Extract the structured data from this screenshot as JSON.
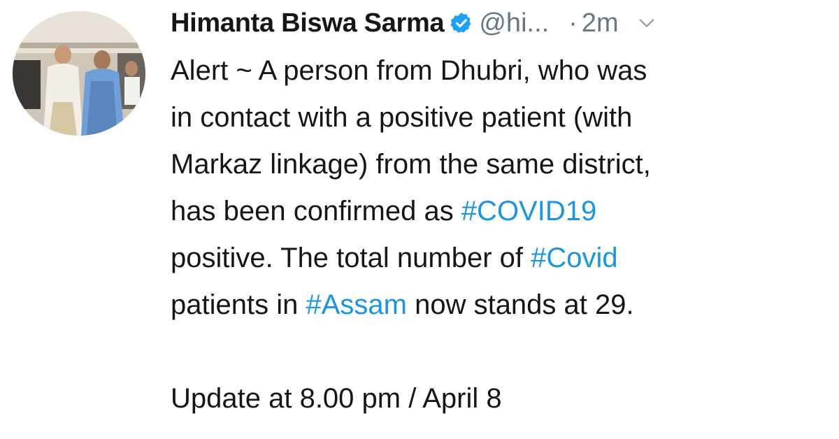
{
  "author": {
    "display_name": "Himanta Biswa Sarma",
    "handle": "@hi...",
    "separator": "·",
    "time": "2m",
    "verified_icon": "verified-badge-icon",
    "menu_icon": "chevron-down-icon"
  },
  "tweet": {
    "lines": [
      {
        "text": "Alert ~ A person from Dhubri, who was"
      },
      {
        "text": "in contact with a positive patient (with"
      },
      {
        "text": "Markaz linkage) from the same district,"
      },
      {
        "pre": "has been confirmed as ",
        "tag": "#COVID19",
        "post": ""
      },
      {
        "pre": "positive. The total number of ",
        "tag": "#Covid",
        "post": ""
      },
      {
        "pre": "patients in ",
        "tag": "#Assam",
        "post": " now stands at 29."
      }
    ],
    "update_line": "Update at 8.00 pm / April 8"
  },
  "colors": {
    "text": "#14171a",
    "secondary": "#657786",
    "hashtag": "#1b95e0",
    "verified": "#1da1f2"
  }
}
